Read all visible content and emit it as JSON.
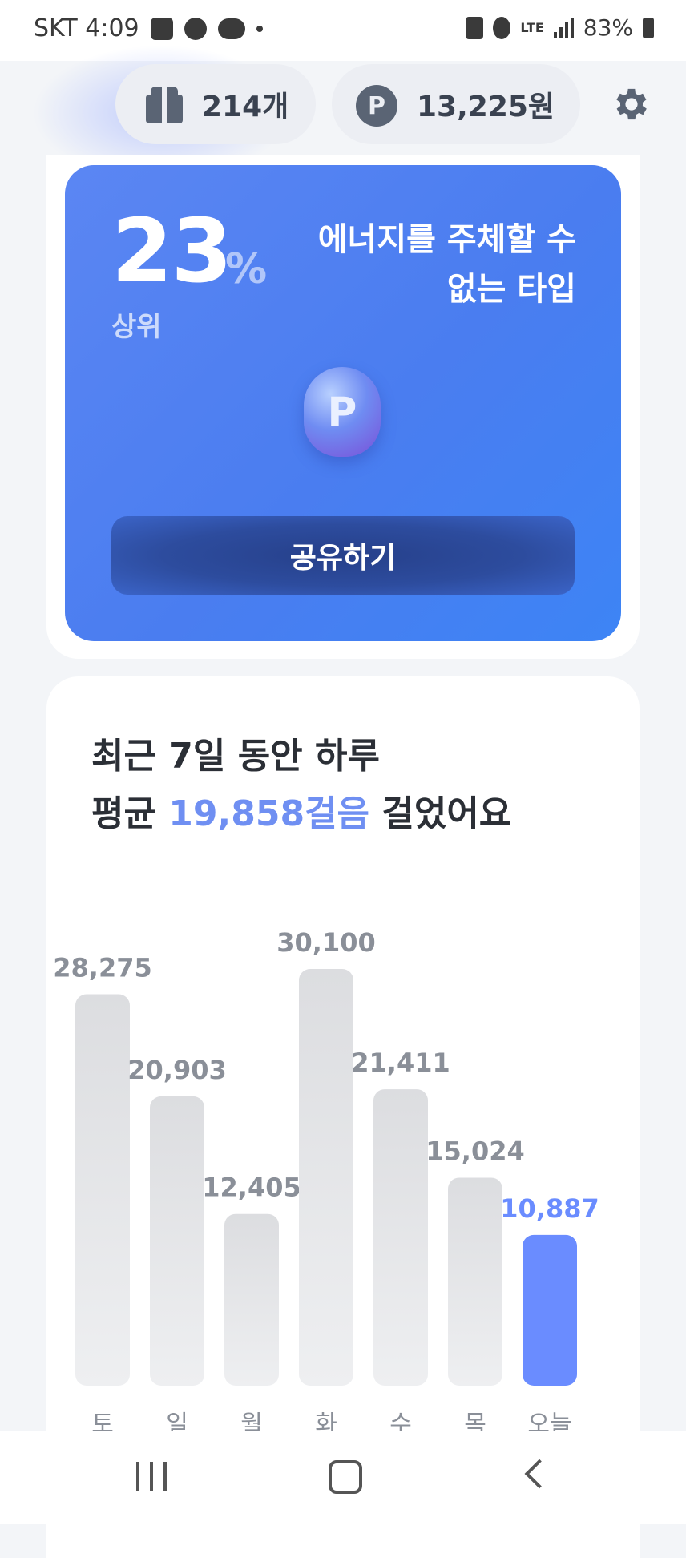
{
  "status_bar": {
    "carrier_time": "SKT 4:09",
    "network": "LTE",
    "battery": "83%"
  },
  "header": {
    "gift_count": "214개",
    "points": "13,225원",
    "point_icon_letter": "P"
  },
  "energy_card": {
    "percent_value": "23",
    "percent_symbol": "%",
    "percent_label": "상위",
    "type_title": "에너지를 주체할 수 없는 타입",
    "coin_letter": "P",
    "share_label": "공유하기"
  },
  "steps_card": {
    "title_line1": "최근 7일 동안 하루",
    "title_prefix": "평균 ",
    "title_highlight": "19,858걸음",
    "title_suffix": " 걸었어요"
  },
  "chart_data": {
    "type": "bar",
    "categories": [
      "토",
      "일",
      "월",
      "화",
      "수",
      "목",
      "오늘"
    ],
    "values": [
      28275,
      20903,
      12405,
      30100,
      21411,
      15024,
      10887
    ],
    "value_labels": [
      "28,275",
      "20,903",
      "12,405",
      "30,100",
      "21,411",
      "15,024",
      "10,887"
    ],
    "highlight_index": 6,
    "colors": {
      "bar": "#e2e3e6",
      "highlight": "#6a8cff",
      "label": "#8a8f98",
      "highlight_label": "#6a8cff"
    }
  },
  "colors": {
    "accent": "#6f8ff2",
    "hero_bg": "#4a7df0",
    "share_button": "#2d4c9e"
  },
  "icons": [
    "gift-icon",
    "point-icon",
    "gear-icon",
    "coin-icon"
  ]
}
